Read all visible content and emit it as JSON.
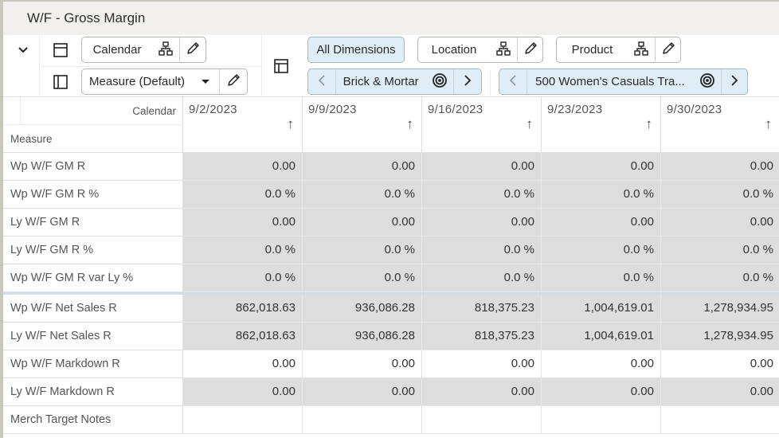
{
  "window": {
    "title": "W/F - Gross Margin"
  },
  "toolbar": {
    "collapse_icon": "chevron-down-icon",
    "row_axis": {
      "layout_icon": "row-layout-icon",
      "dimension_label": "Calendar",
      "hierarchy_icon": "hierarchy-icon",
      "edit_icon": "pencil-icon"
    },
    "column_axis": {
      "layout_icon": "column-layout-icon",
      "dimension_label": "Measure (Default)",
      "dropdown_icon": "caret-down-icon",
      "edit_icon": "pencil-icon"
    },
    "page_axis_icon": "page-layout-icon",
    "all_dimensions_label": "All Dimensions",
    "location": {
      "label": "Location",
      "hierarchy_icon": "hierarchy-icon",
      "edit_icon": "pencil-icon",
      "current_value": "Brick & Mortar",
      "prev_icon": "chevron-left-icon",
      "target_icon": "target-icon",
      "next_icon": "chevron-right-icon"
    },
    "product": {
      "label": "Product",
      "hierarchy_icon": "hierarchy-icon",
      "edit_icon": "pencil-icon",
      "current_value": "500 Women's Casuals Tra...",
      "prev_icon": "chevron-left-icon",
      "target_icon": "target-icon",
      "next_icon": "chevron-right-icon"
    }
  },
  "grid": {
    "corner": {
      "column_dimension": "Calendar",
      "row_dimension": "Measure"
    },
    "columns": [
      {
        "date": "9/2/2023",
        "sort_icon": "arrow-up-icon"
      },
      {
        "date": "9/9/2023",
        "sort_icon": "arrow-up-icon"
      },
      {
        "date": "9/16/2023",
        "sort_icon": "arrow-up-icon"
      },
      {
        "date": "9/23/2023",
        "sort_icon": "arrow-up-icon"
      },
      {
        "date": "9/30/2023",
        "sort_icon": "arrow-up-icon"
      }
    ],
    "rows": [
      {
        "measure": "Wp W/F GM R",
        "editable": false,
        "values": [
          "0.00",
          "0.00",
          "0.00",
          "0.00",
          "0.00"
        ]
      },
      {
        "measure": "Wp W/F GM R %",
        "editable": false,
        "values": [
          "0.0 %",
          "0.0 %",
          "0.0 %",
          "0.0 %",
          "0.0 %"
        ]
      },
      {
        "measure": "Ly W/F GM R",
        "editable": false,
        "values": [
          "0.00",
          "0.00",
          "0.00",
          "0.00",
          "0.00"
        ]
      },
      {
        "measure": "Ly W/F GM R %",
        "editable": false,
        "values": [
          "0.0 %",
          "0.0 %",
          "0.0 %",
          "0.0 %",
          "0.0 %"
        ]
      },
      {
        "measure": "Wp W/F GM R var Ly %",
        "editable": false,
        "values": [
          "0.0 %",
          "0.0 %",
          "0.0 %",
          "0.0 %",
          "0.0 %"
        ]
      },
      {
        "measure": "Wp W/F Net Sales R",
        "editable": false,
        "values": [
          "862,018.63",
          "936,086.28",
          "818,375.23",
          "1,004,619.01",
          "1,278,934.95"
        ]
      },
      {
        "measure": "Ly W/F Net Sales R",
        "editable": false,
        "values": [
          "862,018.63",
          "936,086.28",
          "818,375.23",
          "1,004,619.01",
          "1,278,934.95"
        ]
      },
      {
        "measure": "Wp W/F Markdown R",
        "editable": true,
        "values": [
          "0.00",
          "0.00",
          "0.00",
          "0.00",
          "0.00"
        ]
      },
      {
        "measure": "Ly W/F Markdown R",
        "editable": false,
        "values": [
          "0.00",
          "0.00",
          "0.00",
          "0.00",
          "0.00"
        ]
      },
      {
        "measure": "Merch Target Notes",
        "editable": true,
        "values": [
          "",
          "",
          "",
          "",
          ""
        ]
      }
    ]
  }
}
